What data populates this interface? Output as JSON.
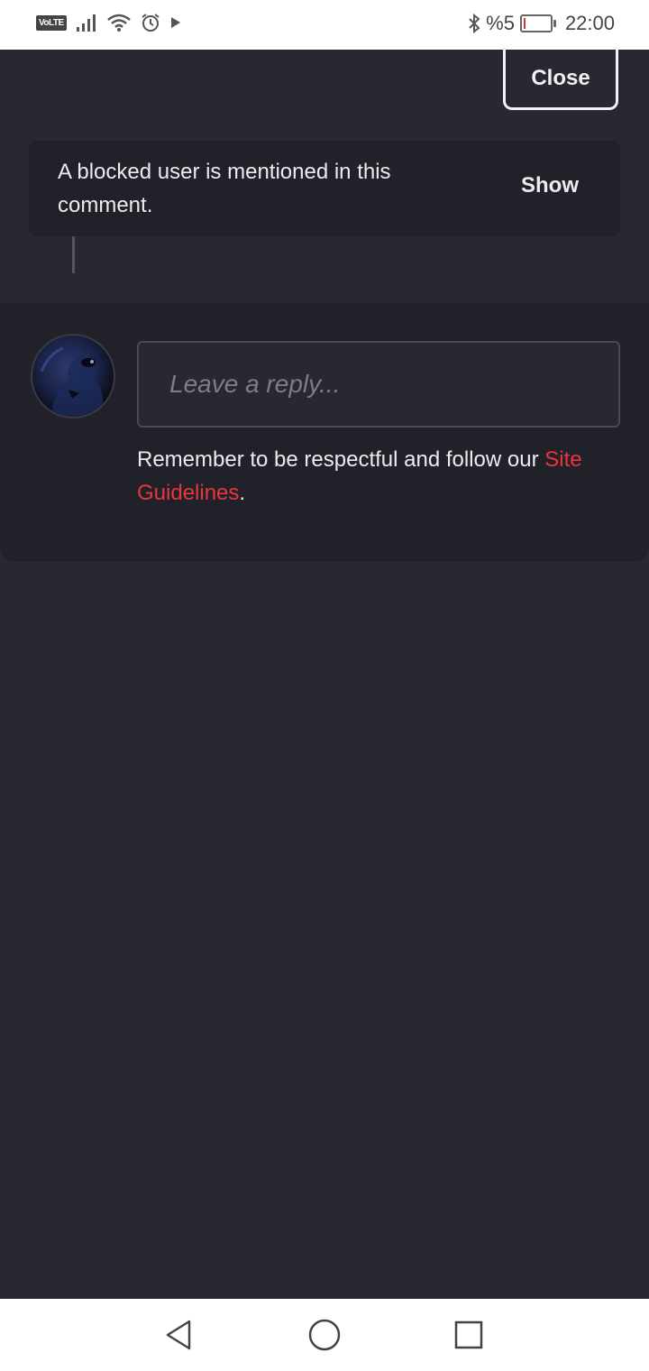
{
  "status_bar": {
    "volte_label": "VoLTE",
    "battery_text": "%5",
    "battery_level_percent": 5,
    "time": "22:00",
    "icons": [
      "volte-icon",
      "signal-icon",
      "wifi-icon",
      "alarm-icon",
      "play-icon",
      "bluetooth-icon",
      "battery-icon"
    ]
  },
  "header": {
    "close_label": "Close"
  },
  "blocked_notice": {
    "text": "A blocked user is mentioned in this comment.",
    "show_label": "Show"
  },
  "reply": {
    "placeholder": "Leave a reply...",
    "guidelines_prefix": "Remember to be respectful and follow our ",
    "guidelines_link": "Site Guidelines",
    "guidelines_suffix": "."
  },
  "nav_bar": {
    "icons": [
      "back-icon",
      "home-icon",
      "recents-icon"
    ]
  },
  "colors": {
    "background": "#282832",
    "panel": "#21212a",
    "link": "#e8363a"
  }
}
